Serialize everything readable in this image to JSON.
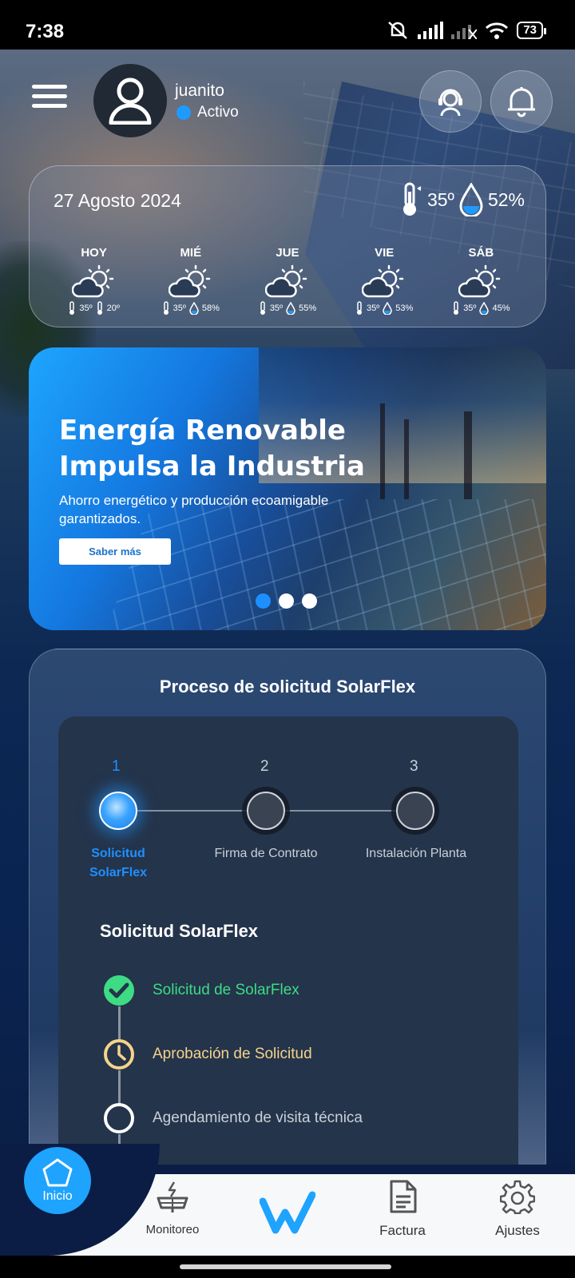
{
  "status_bar": {
    "time": "7:38",
    "battery": "73"
  },
  "header": {
    "username": "juanito",
    "status": "Activo"
  },
  "weather": {
    "date": "27 Agosto 2024",
    "current_temp": "35º",
    "current_humidity": "52%",
    "days": [
      {
        "name": "HOY",
        "temp": "35º",
        "second": "20º",
        "second_type": "temp"
      },
      {
        "name": "MIÉ",
        "temp": "35º",
        "second": "58%",
        "second_type": "humidity"
      },
      {
        "name": "JUE",
        "temp": "35º",
        "second": "55%",
        "second_type": "humidity"
      },
      {
        "name": "VIE",
        "temp": "35º",
        "second": "53%",
        "second_type": "humidity"
      },
      {
        "name": "SÁB",
        "temp": "35º",
        "second": "45%",
        "second_type": "humidity"
      }
    ]
  },
  "banner": {
    "title_line1": "Energía Renovable",
    "title_line2": "Impulsa la Industria",
    "subtitle": "Ahorro energético y producción ecoamigable garantizados.",
    "button": "Saber más",
    "active_slide": 1,
    "slide_count": 3
  },
  "process": {
    "title": "Proceso de solicitud SolarFlex",
    "steps": [
      {
        "num": "1",
        "label": "Solicitud SolarFlex",
        "active": true
      },
      {
        "num": "2",
        "label": "Firma de Contrato",
        "active": false
      },
      {
        "num": "3",
        "label": "Instalación Planta",
        "active": false
      }
    ],
    "subtitle": "Solicitud SolarFlex",
    "timeline": [
      {
        "label": "Solicitud de SolarFlex",
        "state": "done",
        "color": "#3ddc84"
      },
      {
        "label": "Aprobación de Solicitud",
        "state": "pending",
        "color": "#f5d38a"
      },
      {
        "label": "Agendamiento de visita técnica",
        "state": "todo",
        "color": "#c9d0d8"
      }
    ]
  },
  "navbar": {
    "home": "Inicio",
    "monitoreo": "Monitoreo",
    "factura": "Factura",
    "ajustes": "Ajustes"
  },
  "colors": {
    "accent": "#1ea3ff",
    "done": "#3ddc84",
    "pending": "#f5d38a"
  }
}
